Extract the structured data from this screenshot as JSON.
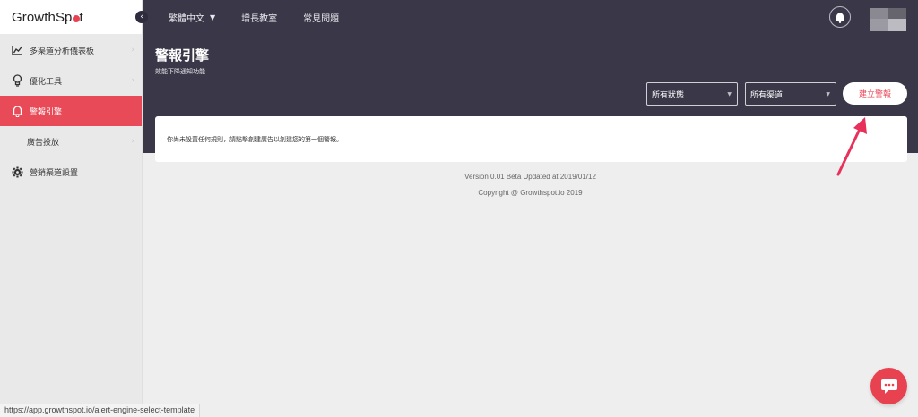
{
  "brand": {
    "name_part1": "GrowthSp",
    "name_part2": "t"
  },
  "topbar": {
    "links": [
      {
        "label": "繁體中文"
      },
      {
        "label": "增長教室"
      },
      {
        "label": "常見問題"
      }
    ]
  },
  "sidebar": {
    "items": [
      {
        "label": "多渠道分析儀表板",
        "icon": "chart-line-icon"
      },
      {
        "label": "優化工具",
        "icon": "lightbulb-icon"
      },
      {
        "label": "警報引擎",
        "icon": "bell-icon",
        "active": true
      },
      {
        "label": "廣告投放",
        "icon": ""
      },
      {
        "label": "營銷渠道設置",
        "icon": "gear-icon"
      }
    ]
  },
  "header": {
    "title": "警報引擎",
    "subtitle": "效能下降通知功能"
  },
  "filters": {
    "status": {
      "selected": "所有狀態"
    },
    "channel": {
      "selected": "所有渠道"
    }
  },
  "create_button": {
    "label": "建立警報"
  },
  "empty_state": {
    "message": "你尚未設置任何規則，請點擊創建廣告以創建您的第一個警報。"
  },
  "footer": {
    "version": "Version 0.01 Beta Updated at 2019/01/12",
    "copyright": "Copyright @ Growthspot.io 2019"
  },
  "statusbar": {
    "url": "https://app.growthspot.io/alert-engine-select-template"
  },
  "colors": {
    "accent": "#e84a58",
    "header_bg": "#3a3848",
    "sidebar_bg": "#eae9e9"
  }
}
